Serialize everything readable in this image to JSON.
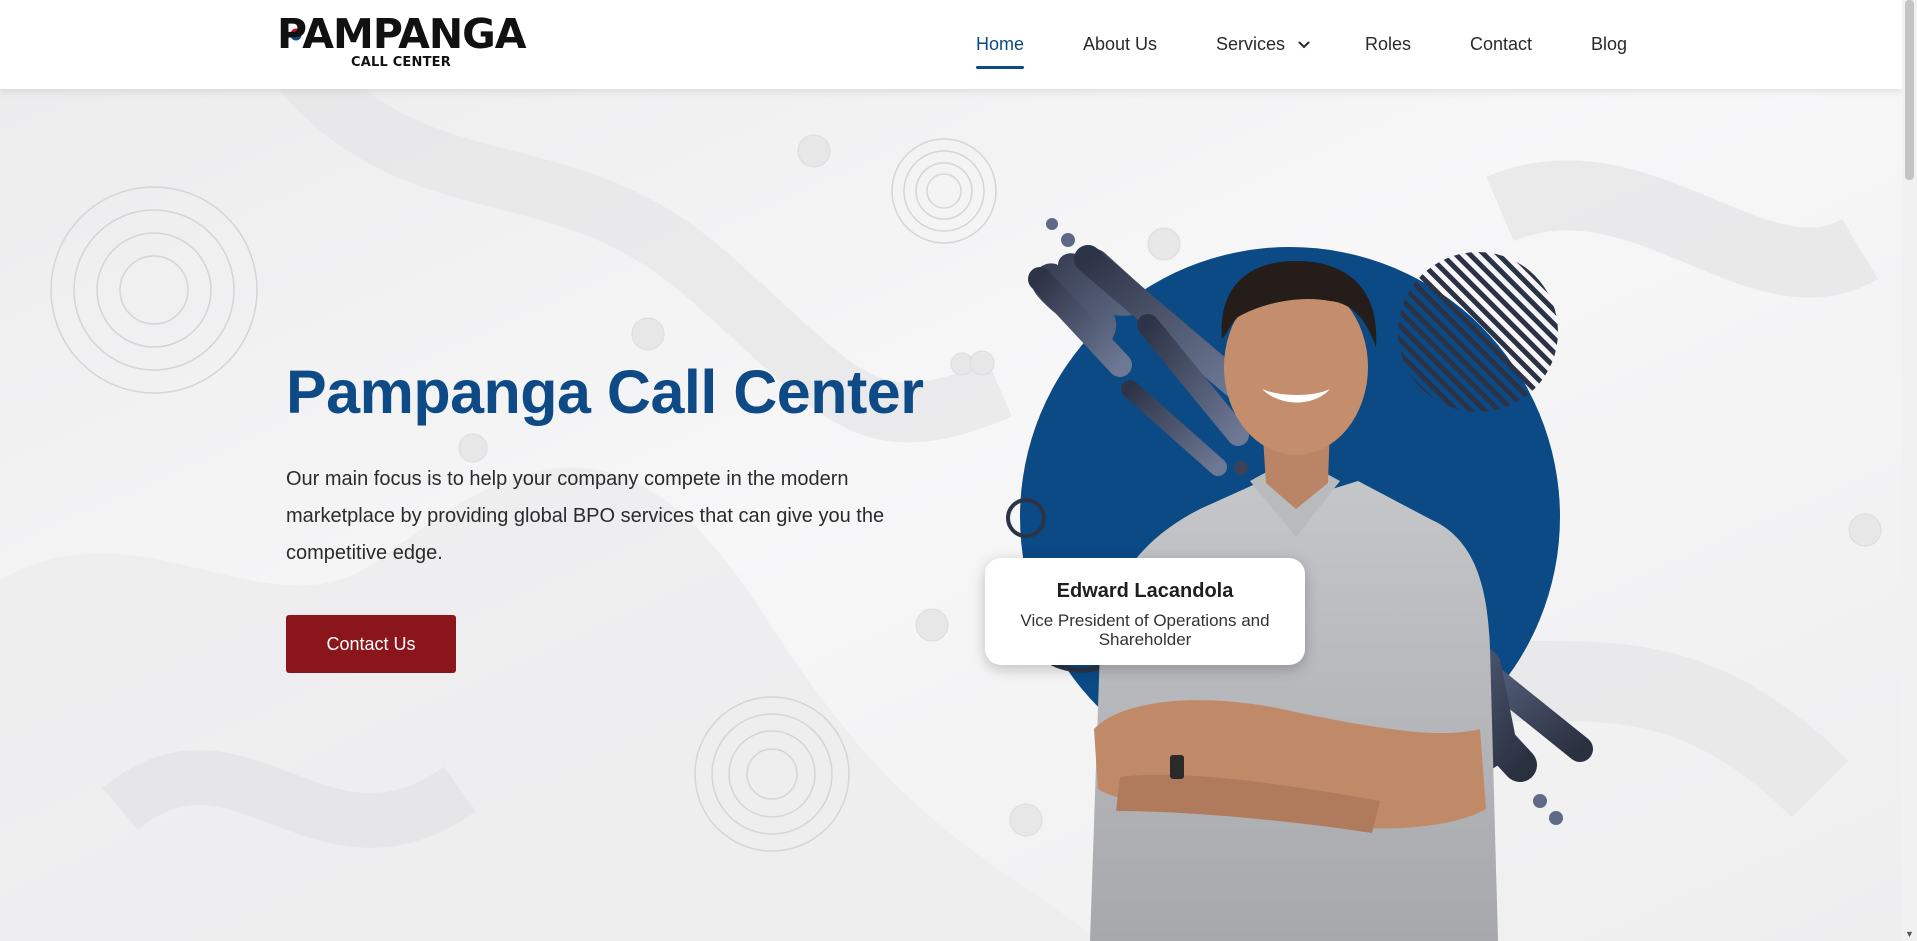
{
  "brand": {
    "name": "PAMPANGA",
    "tagline": "CALL CENTER",
    "primary_color": "#0d4a86",
    "accent_color": "#8a151b"
  },
  "nav": {
    "items": [
      {
        "label": "Home",
        "active": true
      },
      {
        "label": "About Us",
        "active": false
      },
      {
        "label": "Services",
        "active": false,
        "has_dropdown": true
      },
      {
        "label": "Roles",
        "active": false
      },
      {
        "label": "Contact",
        "active": false
      },
      {
        "label": "Blog",
        "active": false
      }
    ]
  },
  "hero": {
    "title": "Pampanga Call Center",
    "description": "Our main focus is to help your company compete in the modern marketplace by providing global BPO services that can give you the competitive edge.",
    "cta_label": "Contact Us"
  },
  "person": {
    "name": "Edward Lacandola",
    "role": "Vice President of Operations and Shareholder"
  },
  "icons": [
    "chevron-down-icon",
    "logo-mark-icon"
  ]
}
